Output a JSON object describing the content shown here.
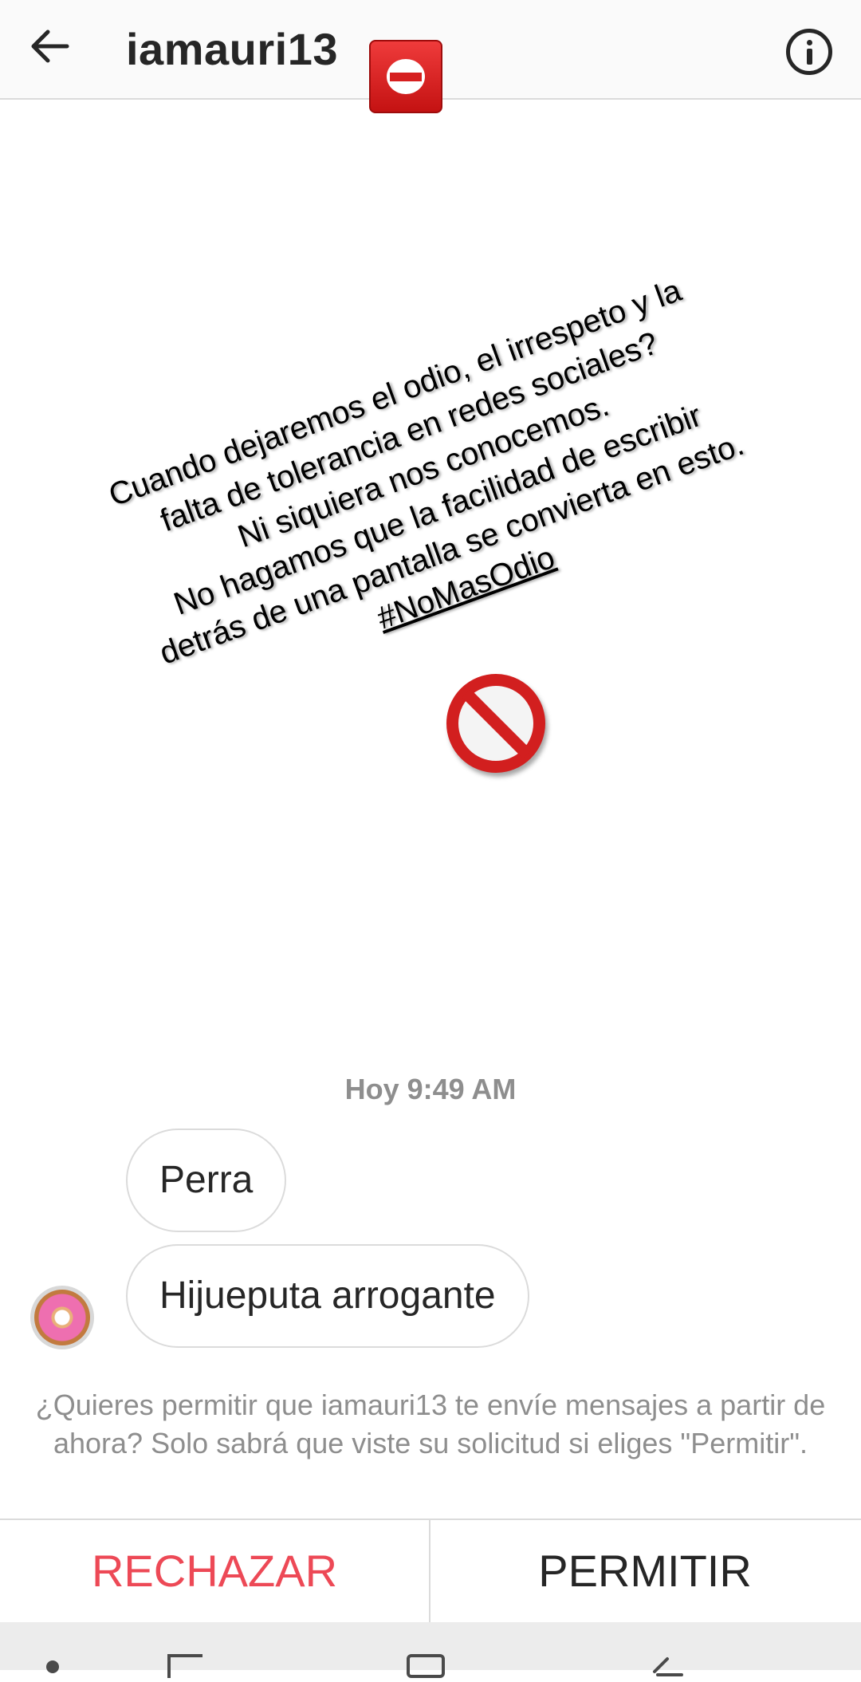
{
  "header": {
    "username": "iamauri13",
    "back_icon": "arrow-left-icon",
    "badge_emoji": "no-entry-emoji",
    "info_icon": "info-icon"
  },
  "story": {
    "lines": [
      "Cuando dejaremos el odio, el irrespeto y la",
      "falta de tolerancia en redes sociales?",
      "Ni siquiera nos conocemos.",
      "No hagamos que la facilidad de escribir",
      "detrás de una pantalla se convierta en esto."
    ],
    "hashtag": "#NoMasOdio",
    "icon": "prohibited-icon"
  },
  "thread": {
    "timestamp": "Hoy 9:49 AM",
    "messages": [
      "Perra",
      "Hijueputa arrogante"
    ],
    "avatar": "donut-avatar"
  },
  "request": {
    "text": "¿Quieres permitir que iamauri13 te envíe mensajes a partir de ahora? Solo sabrá que viste su solicitud si eliges \"Permitir\".",
    "reject_label": "RECHAZAR",
    "allow_label": "PERMITIR"
  },
  "colors": {
    "reject": "#ed4956",
    "text": "#262626",
    "muted": "#8e8e8e"
  }
}
